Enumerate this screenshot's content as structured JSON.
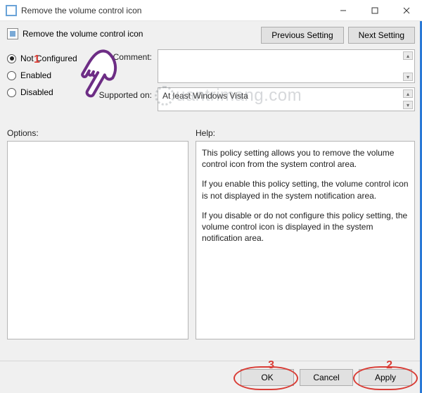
{
  "window": {
    "title": "Remove the volume control icon",
    "subtitle": "Remove the volume control icon"
  },
  "nav": {
    "prev": "Previous Setting",
    "next": "Next Setting"
  },
  "radios": {
    "not_configured": "Not Configured",
    "enabled": "Enabled",
    "disabled": "Disabled"
  },
  "fields": {
    "comment_label": "Comment:",
    "comment_value": "",
    "supported_label": "Supported on:",
    "supported_value": "At least Windows Vista"
  },
  "sections": {
    "options": "Options:",
    "help": "Help:"
  },
  "help": {
    "p1": "This policy setting allows you to remove the volume control icon from the system control area.",
    "p2": "If you enable this policy setting, the volume control icon is not displayed in the system notification area.",
    "p3": "If you disable or do not configure this policy setting, the volume control icon is displayed in the system notification area."
  },
  "footer": {
    "ok": "OK",
    "cancel": "Cancel",
    "apply": "Apply"
  },
  "watermark": "uantrimang.com",
  "annotations": {
    "n1": "1",
    "n2": "2",
    "n3": "3"
  }
}
